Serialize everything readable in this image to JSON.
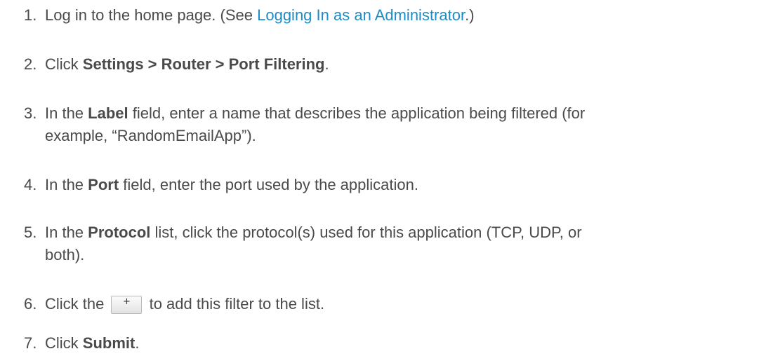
{
  "steps": [
    {
      "num": "1.",
      "text_a": "Log in to the home page. (See ",
      "link": "Logging In as an Administrator",
      "text_b": ".)"
    },
    {
      "num": "2.",
      "text_a": "Click ",
      "bold": "Settings > Router > Port Filtering",
      "text_b": "."
    },
    {
      "num": "3.",
      "text_a": "In the ",
      "bold": "Label",
      "text_b": " field, enter a name that describes the application being filtered (for",
      "text_c": "example, “RandomEmailApp”)."
    },
    {
      "num": "4.",
      "text_a": "In the ",
      "bold": "Port",
      "text_b": " field, enter the port used by the application."
    },
    {
      "num": "5.",
      "text_a": "In the ",
      "bold": "Protocol",
      "text_b": " list, click the protocol(s) used for this application (TCP, UDP, or",
      "text_c": "both)."
    },
    {
      "num": "6.",
      "text_a": "Click the ",
      "button_glyph": "+",
      "text_b": " to add this filter to the list."
    },
    {
      "num": "7.",
      "text_a": "Click ",
      "bold": "Submit",
      "text_b": "."
    }
  ],
  "colors": {
    "text": "#4a4a4a",
    "link": "#1e8bc3"
  }
}
